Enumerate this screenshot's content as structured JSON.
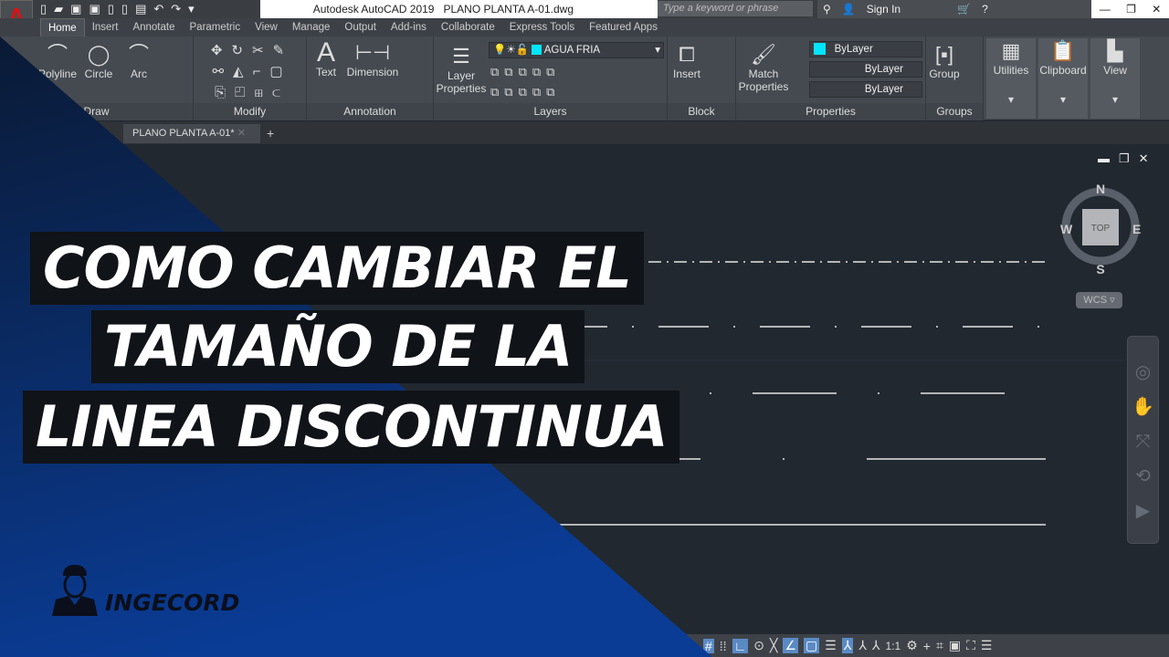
{
  "app": {
    "logo": "A",
    "title": "Autodesk AutoCAD 2019",
    "file": "PLANO PLANTA A-01.dwg",
    "search_placeholder": "Type a keyword or phrase",
    "signin": "Sign In"
  },
  "quick_access_icons": [
    "new-icon",
    "open-icon",
    "save-icon",
    "saveas-icon",
    "cloud-open-icon",
    "cloud-save-icon",
    "print-icon",
    "undo-icon",
    "redo-icon",
    "customize-icon"
  ],
  "ribbon_tabs": [
    "Home",
    "Insert",
    "Annotate",
    "Parametric",
    "View",
    "Manage",
    "Output",
    "Add-ins",
    "Collaborate",
    "Express Tools",
    "Featured Apps"
  ],
  "panels": {
    "draw": {
      "title": "Draw",
      "buttons": [
        "Polyline",
        "Circle",
        "Arc"
      ]
    },
    "modify": {
      "title": "Modify"
    },
    "annotation": {
      "title": "Annotation",
      "buttons": [
        "Text",
        "Dimension"
      ]
    },
    "layers": {
      "title": "Layers",
      "layer_properties": "Layer Properties",
      "current_layer": "AGUA FRIA",
      "layer_color": "#00e5ff"
    },
    "block": {
      "title": "Block",
      "insert": "Insert"
    },
    "properties": {
      "title": "Properties",
      "match": "Match Properties",
      "color": "ByLayer",
      "lineweight": "ByLayer",
      "linetype": "ByLayer"
    },
    "groups": {
      "title": "Groups",
      "group": "Group"
    },
    "utilities": "Utilities",
    "clipboard": "Clipboard",
    "view": "View"
  },
  "doc_tab": "PLANO PLANTA A-01*",
  "viewcube": {
    "n": "N",
    "s": "S",
    "e": "E",
    "w": "W",
    "face": "TOP",
    "ucs": "WCS"
  },
  "status_bar": {
    "scale": "1:1"
  },
  "headline": [
    "COMO CAMBIAR EL",
    "TAMAÑO DE LA",
    "LINEA DISCONTINUA"
  ],
  "brand": "INGECORD",
  "colors": {
    "overlay_top": "#0a1a35",
    "overlay_bottom": "#0a3c96",
    "drawing_bg": "#212830"
  }
}
